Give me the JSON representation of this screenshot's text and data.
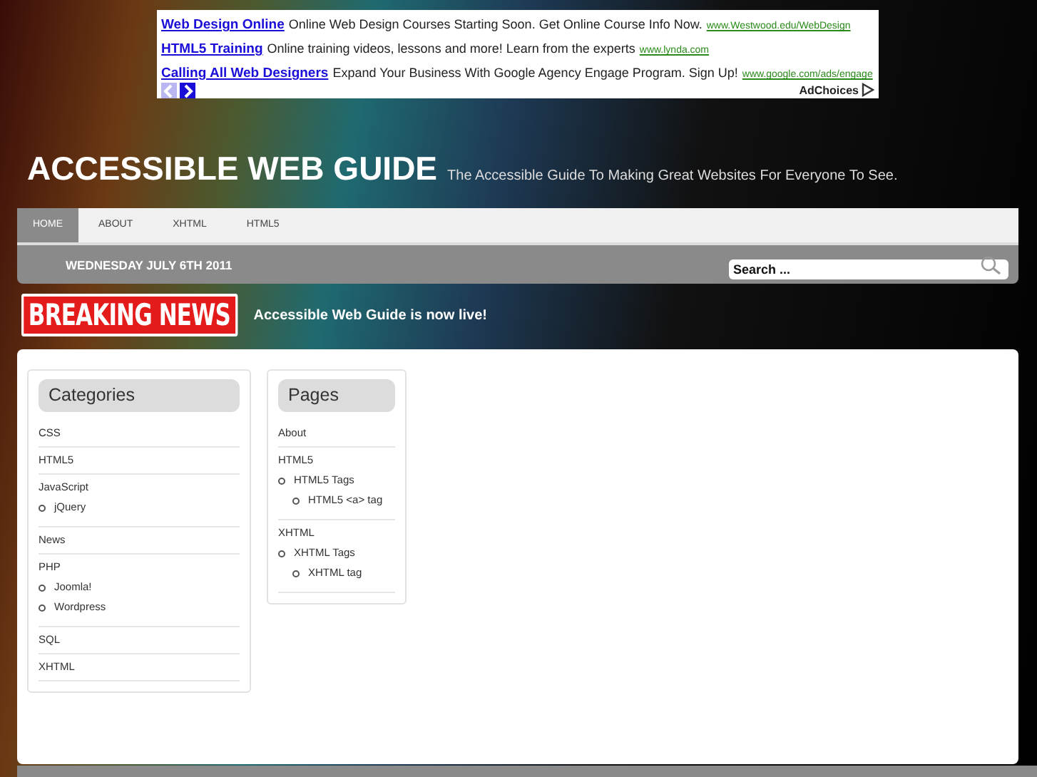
{
  "ad": {
    "items": [
      {
        "title": "Web Design Online",
        "text": "Online Web Design Courses Starting Soon. Get Online Course Info Now.",
        "url": "www.Westwood.edu/WebDesign"
      },
      {
        "title": "HTML5 Training",
        "text": "Online training videos, lessons and more! Learn from the experts",
        "url": "www.lynda.com"
      },
      {
        "title": "Calling All Web Designers",
        "text": "Expand Your Business With Google Agency Engage Program. Sign Up!",
        "url": "www.google.com/ads/engage"
      }
    ],
    "pager": [
      {
        "kind": "prev",
        "disabled": true
      },
      {
        "kind": "next",
        "disabled": false
      }
    ],
    "adchoices": "AdChoices"
  },
  "site": {
    "title": "ACCESSIBLE WEB GUIDE",
    "tagline": "The Accessible Guide To Making Great Websites For Everyone To See."
  },
  "nav": [
    {
      "label": "HOME",
      "selected": true
    },
    {
      "label": "ABOUT",
      "selected": false
    },
    {
      "label": "XHTML",
      "selected": false
    },
    {
      "label": "HTML5",
      "selected": false
    }
  ],
  "date": "WEDNESDAY JULY 6TH 2011",
  "search": {
    "value": "Search ..."
  },
  "breaking": {
    "badge": "BREAKING NEWS",
    "text": "Accessible Web Guide is now live!"
  },
  "widgets": [
    {
      "title": "Categories",
      "items": [
        {
          "label": "CSS"
        },
        {
          "label": "HTML5"
        },
        {
          "label": "JavaScript",
          "children": [
            {
              "label": "jQuery"
            }
          ]
        },
        {
          "label": "News"
        },
        {
          "label": "PHP",
          "children": [
            {
              "label": "Joomla!"
            },
            {
              "label": "Wordpress"
            }
          ]
        },
        {
          "label": "SQL"
        },
        {
          "label": "XHTML"
        }
      ]
    },
    {
      "title": "Pages",
      "items": [
        {
          "label": "About"
        },
        {
          "label": "HTML5",
          "children": [
            {
              "label": "HTML5 Tags",
              "children": [
                {
                  "label": "HTML5 <a> tag"
                }
              ]
            }
          ]
        },
        {
          "label": "XHTML",
          "children": [
            {
              "label": "XHTML Tags",
              "children": [
                {
                  "label": "XHTML tag"
                }
              ]
            }
          ]
        }
      ]
    }
  ]
}
